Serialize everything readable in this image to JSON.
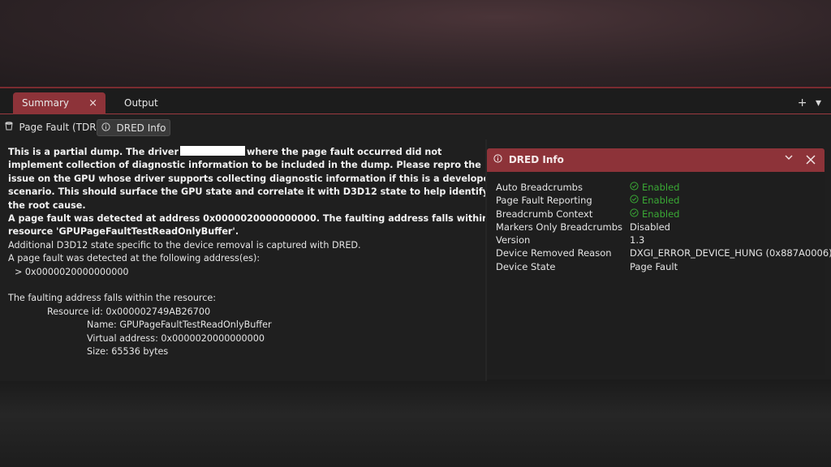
{
  "tabs": [
    {
      "label": "Summary",
      "close": "×"
    },
    {
      "label": "Output"
    }
  ],
  "tab_actions": {
    "add": "+",
    "dropdown": "▾"
  },
  "subtabs": [
    {
      "label": "Page Fault (TDR)"
    },
    {
      "label": "DRED Info"
    }
  ],
  "summary": {
    "l1a": "This is a partial dump. The driver",
    "l1b": "where the page fault occurred did not",
    "l2": "implement collection of diagnostic information to be included in the dump. Please repro the",
    "l3": "issue on the GPU whose driver supports collecting diagnostic information if this is a developer",
    "l4": "scenario. This should surface the GPU state and correlate it with D3D12 state to help identify",
    "l5": "the root cause.",
    "l6": "A page fault was detected at address 0x0000020000000000. The faulting address falls within",
    "l7": "resource 'GPUPageFaultTestReadOnlyBuffer'.",
    "l8": "Additional D3D12 state specific to the device removal is captured with DRED.",
    "l9": "A page fault was detected at the following address(es):",
    "l10": "> 0x0000020000000000",
    "l11": "The faulting address falls within the resource:",
    "l12": "Resource id: 0x000002749AB26700",
    "l13": "Name: GPUPageFaultTestReadOnlyBuffer",
    "l14": "Virtual address: 0x0000020000000000",
    "l15": "Size: 65536 bytes"
  },
  "dred_panel": {
    "title": "DRED Info",
    "properties": [
      {
        "key": "Auto Breadcrumbs",
        "value": "Enabled"
      },
      {
        "key": "Page Fault Reporting",
        "value": "Enabled"
      },
      {
        "key": "Breadcrumb Context",
        "value": "Enabled"
      },
      {
        "key": "Markers Only Breadcrumbs",
        "value": "Disabled"
      },
      {
        "key": "Version",
        "value": "1.3"
      },
      {
        "key": "Device Removed Reason",
        "value": "DXGI_ERROR_DEVICE_HUNG (0x887A0006)"
      },
      {
        "key": "Device State",
        "value": "Page Fault"
      }
    ]
  },
  "colors": {
    "accent": "#8d3339",
    "enabled": "#3aa935",
    "background": "#1f1f1f"
  },
  "icons": {
    "close": "close-icon",
    "add": "plus-icon",
    "dropdown": "chevron-down-icon",
    "page_fault": "bucket-icon",
    "dred": "info-icon",
    "check": "check-circle-icon"
  }
}
